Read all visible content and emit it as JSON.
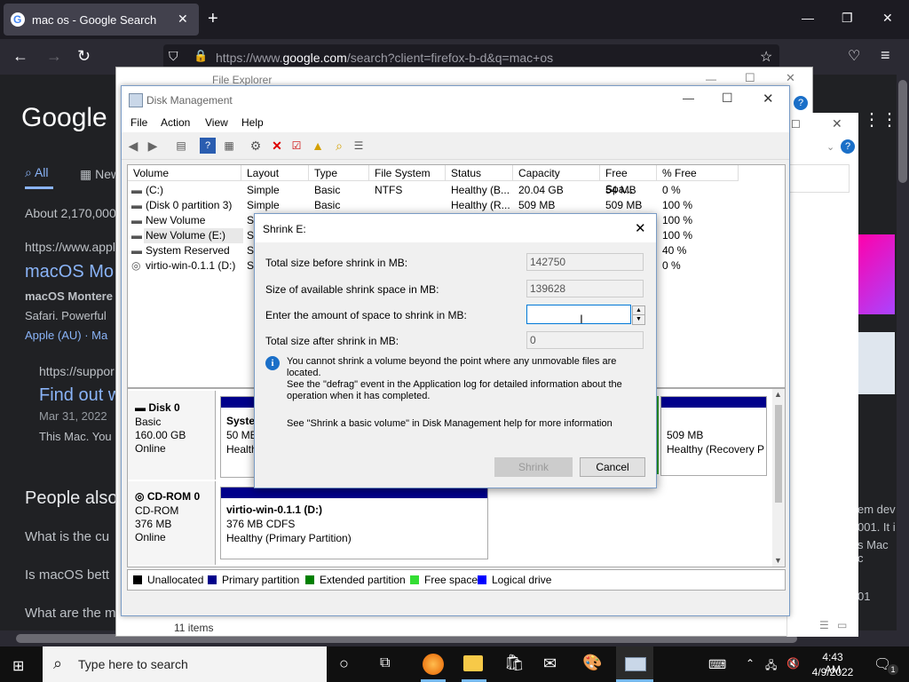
{
  "browser": {
    "tab_title": "mac os - Google Search",
    "url_prefix": "https://www.",
    "url_domain": "google.com",
    "url_rest": "/search?client=firefox-b-d&q=mac+os"
  },
  "google": {
    "logo": "Google",
    "tab_all": "All",
    "tab_news": "News",
    "about": "About 2,170,000",
    "result1_url": "https://www.apple",
    "result1_title": "macOS Mo",
    "result1_snippet_a": "macOS Montere",
    "result1_snippet_b": "Safari. Powerful",
    "result1_sub": "Apple (AU) · Ma",
    "result2_url": "https://suppor",
    "result2_title": "Find out w",
    "result2_date": "Mar 31, 2022",
    "result2_snippet": "This Mac. You",
    "paa_heading": "People also",
    "paa_q1": "What is the cu",
    "paa_q2": "Is macOS bett",
    "paa_q3": "What are the macOS",
    "right_snip1": "em dev",
    "right_snip2": "001. It i",
    "right_snip3": "s Mac c",
    "right_snip4": "01"
  },
  "explorer": {
    "title": "File Explorer",
    "status": "11 items"
  },
  "disk_mgmt": {
    "title": "Disk Management",
    "menu": [
      "File",
      "Action",
      "View",
      "Help"
    ],
    "columns": [
      "Volume",
      "Layout",
      "Type",
      "File System",
      "Status",
      "Capacity",
      "Free Spa...",
      "% Free"
    ],
    "volumes": [
      {
        "volume": "(C:)",
        "layout": "Simple",
        "type": "Basic",
        "fs": "NTFS",
        "status": "Healthy (B...",
        "capacity": "20.04 GB",
        "free": "54 MB",
        "pct": "0 %"
      },
      {
        "volume": "(Disk 0 partition 3)",
        "layout": "Simple",
        "type": "Basic",
        "fs": "",
        "status": "Healthy (R...",
        "capacity": "509 MB",
        "free": "509 MB",
        "pct": "100 %"
      },
      {
        "volume": "New Volume",
        "layout": "Si",
        "type": "",
        "fs": "",
        "status": "",
        "capacity": "",
        "free": "",
        "pct": "100 %"
      },
      {
        "volume": "New Volume (E:)",
        "layout": "Si",
        "type": "",
        "fs": "",
        "status": "",
        "capacity": "",
        "free": "",
        "pct": "100 %"
      },
      {
        "volume": "System Reserved",
        "layout": "Si",
        "type": "",
        "fs": "",
        "status": "",
        "capacity": "",
        "free": "",
        "pct": "40 %"
      },
      {
        "volume": "virtio-win-0.1.1 (D:)",
        "layout": "Si",
        "type": "",
        "fs": "",
        "status": "",
        "capacity": "",
        "free": "",
        "pct": "0 %"
      }
    ],
    "disk0": {
      "name": "Disk 0",
      "type": "Basic",
      "size": "160.00 GB",
      "state": "Online",
      "part1_name": "Syster",
      "part1_size": "50 MB",
      "part1_status": "Healthy",
      "part_last_size": "509 MB",
      "part_last_status": "Healthy (Recovery P"
    },
    "cdrom0": {
      "name": "CD-ROM 0",
      "type": "CD-ROM",
      "size": "376 MB",
      "state": "Online",
      "part_name": "virtio-win-0.1.1  (D:)",
      "part_size": "376 MB CDFS",
      "part_status": "Healthy (Primary Partition)"
    },
    "legend": [
      {
        "label": "Unallocated",
        "color": "#000000"
      },
      {
        "label": "Primary partition",
        "color": "#00008b"
      },
      {
        "label": "Extended partition",
        "color": "#008000"
      },
      {
        "label": "Free space",
        "color": "#33dd33"
      },
      {
        "label": "Logical drive",
        "color": "#0000ff"
      }
    ]
  },
  "dialog": {
    "title": "Shrink E:",
    "total_before_label": "Total size before shrink in MB:",
    "total_before_value": "142750",
    "available_label": "Size of available shrink space in MB:",
    "available_value": "139628",
    "amount_label": "Enter the amount of space to shrink in MB:",
    "amount_value": "",
    "total_after_label": "Total size after shrink in MB:",
    "total_after_value": "0",
    "info_line1": "You cannot shrink a volume beyond the point where any unmovable files are located.",
    "info_line2": "See the \"defrag\" event in the Application log for detailed information about the",
    "info_line3": "operation when it has completed.",
    "help_text": "See \"Shrink a basic volume\" in Disk Management help for more information",
    "shrink_button": "Shrink",
    "cancel_button": "Cancel"
  },
  "taskbar": {
    "search_placeholder": "Type here to search",
    "time": "4:43 AM",
    "date": "4/9/2022",
    "notification_count": "1"
  }
}
